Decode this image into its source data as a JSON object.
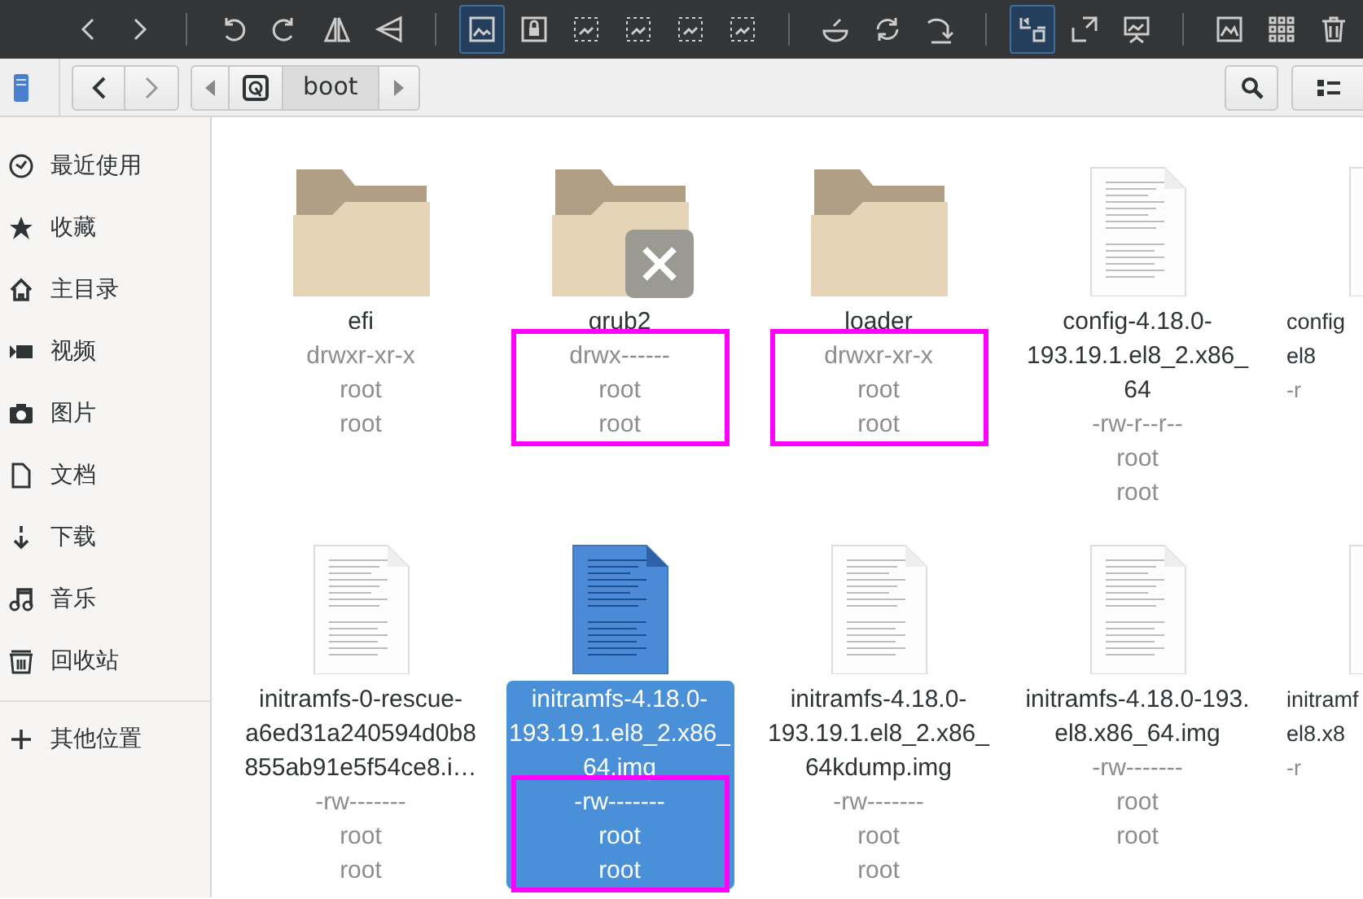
{
  "toolbar": {
    "tools": [
      {
        "kind": "back",
        "active": false
      },
      {
        "kind": "forward",
        "active": false
      },
      {
        "kind": "separator"
      },
      {
        "kind": "rotate-left",
        "active": false
      },
      {
        "kind": "rotate-right",
        "active": false
      },
      {
        "kind": "flip-horizontal",
        "active": false
      },
      {
        "kind": "flip-vertical",
        "active": false
      },
      {
        "kind": "separator"
      },
      {
        "kind": "picture-frame",
        "active": true
      },
      {
        "kind": "lock",
        "active": false
      },
      {
        "kind": "picture-dashed",
        "active": false
      },
      {
        "kind": "picture-dashed",
        "active": false
      },
      {
        "kind": "picture-dashed",
        "active": false
      },
      {
        "kind": "picture-dashed",
        "active": false
      },
      {
        "kind": "separator"
      },
      {
        "kind": "bowl",
        "active": false
      },
      {
        "kind": "cycle",
        "active": false
      },
      {
        "kind": "arrow-down",
        "active": false
      },
      {
        "kind": "separator"
      },
      {
        "kind": "fit",
        "active": true
      },
      {
        "kind": "expand",
        "active": false
      },
      {
        "kind": "presentation",
        "active": false
      },
      {
        "kind": "separator"
      },
      {
        "kind": "picture",
        "active": false
      },
      {
        "kind": "grid",
        "active": false
      },
      {
        "kind": "trash",
        "active": false
      }
    ]
  },
  "pathbar": {
    "segments": [
      {
        "kind": "drive",
        "selected": false
      },
      {
        "kind": "folder",
        "label": "boot",
        "selected": true
      }
    ]
  },
  "sidebar": {
    "items": [
      {
        "kind": "clock",
        "label": "最近使用"
      },
      {
        "kind": "star",
        "label": "收藏"
      },
      {
        "kind": "home",
        "label": "主目录"
      },
      {
        "kind": "video",
        "label": "视频"
      },
      {
        "kind": "camera",
        "label": "图片"
      },
      {
        "kind": "document",
        "label": "文档"
      },
      {
        "kind": "download",
        "label": "下载"
      },
      {
        "kind": "music",
        "label": "音乐"
      },
      {
        "kind": "trash",
        "label": "回收站"
      },
      {
        "kind": "separator"
      },
      {
        "kind": "plus",
        "label": "其他位置"
      }
    ]
  },
  "files": [
    {
      "kind": "folder",
      "name_lines": [
        "efi"
      ],
      "meta": [
        "drwxr-xr-x",
        "root",
        "root"
      ],
      "emblem": false,
      "selected": false,
      "annotated": false
    },
    {
      "kind": "folder",
      "name_lines": [
        "grub2"
      ],
      "meta": [
        "drwx------",
        "root",
        "root"
      ],
      "emblem": true,
      "selected": false,
      "annotated": true
    },
    {
      "kind": "folder",
      "name_lines": [
        "loader"
      ],
      "meta": [
        "drwxr-xr-x",
        "root",
        "root"
      ],
      "emblem": false,
      "selected": false,
      "annotated": true
    },
    {
      "kind": "text-file",
      "name_lines": [
        "config-4.18.0-",
        "193.19.1.el8_2.x86_",
        "64"
      ],
      "meta": [
        "-rw-r--r--",
        "root",
        "root"
      ],
      "emblem": false,
      "selected": false,
      "annotated": false
    },
    {
      "kind": "text-file",
      "name_lines": [
        "config",
        "el8"
      ],
      "meta": [
        "-r"
      ],
      "emblem": false,
      "selected": false,
      "annotated": false
    },
    {
      "kind": "text-file",
      "name_lines": [
        "initramfs-0-rescue-",
        "a6ed31a240594d0b8",
        "855ab91e5f54ce8.i…"
      ],
      "meta": [
        "-rw-------",
        "root",
        "root"
      ],
      "emblem": false,
      "selected": false,
      "annotated": false
    },
    {
      "kind": "text-file",
      "name_lines": [
        "initramfs-4.18.0-",
        "193.19.1.el8_2.x86_",
        "64.img"
      ],
      "meta": [
        "-rw-------",
        "root",
        "root"
      ],
      "emblem": false,
      "selected": true,
      "annotated": true
    },
    {
      "kind": "text-file",
      "name_lines": [
        "initramfs-4.18.0-",
        "193.19.1.el8_2.x86_",
        "64kdump.img"
      ],
      "meta": [
        "-rw-------",
        "root",
        "root"
      ],
      "emblem": false,
      "selected": false,
      "annotated": false
    },
    {
      "kind": "text-file",
      "name_lines": [
        "initramfs-4.18.0-193.",
        "el8.x86_64.img"
      ],
      "meta": [
        "-rw-------",
        "root",
        "root"
      ],
      "emblem": false,
      "selected": false,
      "annotated": false
    },
    {
      "kind": "text-file",
      "name_lines": [
        "initramf",
        "el8.x8"
      ],
      "meta": [
        "-r"
      ],
      "emblem": false,
      "selected": false,
      "annotated": false
    }
  ]
}
